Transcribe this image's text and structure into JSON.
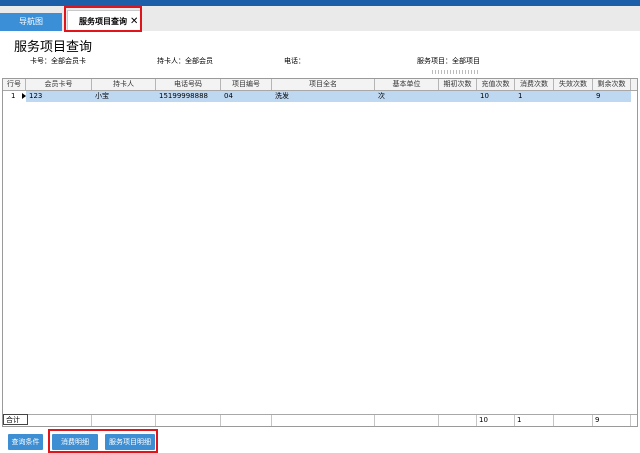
{
  "tabs": [
    {
      "label": "导航图"
    },
    {
      "label": "服务项目查询",
      "close": "✕"
    }
  ],
  "page": {
    "title": "服务项目查询"
  },
  "filters": {
    "card_no": "卡号：全部会员卡",
    "holder": "持卡人：全部会员",
    "phone": "电话：",
    "service": "服务项目：全部项目"
  },
  "table": {
    "columns": [
      "行号",
      "会员卡号",
      "持卡人",
      "电话号码",
      "项目编号",
      "项目全名",
      "基本单位",
      "期初次数",
      "充值次数",
      "消费次数",
      "失效次数",
      "剩余次数"
    ],
    "rows": [
      {
        "row_no": "1",
        "card_no": "123",
        "holder": "小宝",
        "phone": "15199998888",
        "item_code": "04",
        "item_name": "洗发",
        "unit": "次",
        "initial": "",
        "recharge": "10",
        "consumed": "1",
        "expired": "",
        "remaining": "9"
      }
    ],
    "footer": {
      "label": "合计",
      "recharge": "10",
      "consumed": "1",
      "remaining": "9"
    }
  },
  "buttons": {
    "query_conditions": "查询条件",
    "consumption_detail": "消费明细",
    "service_detail": "服务项目明细"
  },
  "colors": {
    "accent": "#3d8ed3",
    "highlight": "#e0151c",
    "selected_row": "#bfd8f2"
  }
}
